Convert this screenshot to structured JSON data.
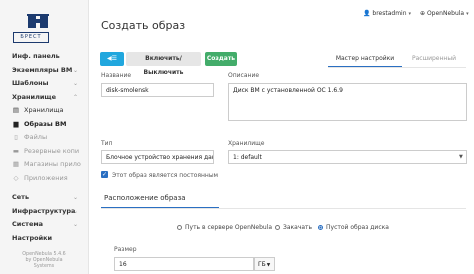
{
  "brand": {
    "logo_text": "БРЕСТ"
  },
  "header": {
    "title": "Создать образ",
    "user": "brestadmin",
    "zone": "OpenNebula"
  },
  "sidebar": {
    "items": [
      {
        "label": "Инф. панель"
      },
      {
        "label": "Экземпляры ВМ"
      },
      {
        "label": "Шаблоны"
      },
      {
        "label": "Хранилище"
      }
    ],
    "storage_subitems": [
      {
        "label": "Хранилища",
        "icon": "storage-icon"
      },
      {
        "label": "Образы ВМ",
        "icon": "image-icon"
      },
      {
        "label": "Файлы",
        "icon": "file-icon"
      },
      {
        "label": "Резервные копи",
        "icon": "backup-icon"
      },
      {
        "label": "Магазины прило",
        "icon": "store-icon"
      },
      {
        "label": "Приложения",
        "icon": "apps-icon"
      }
    ],
    "lower_items": [
      {
        "label": "Сеть"
      },
      {
        "label": "Инфраструктура"
      },
      {
        "label": "Система"
      },
      {
        "label": "Настройки"
      }
    ],
    "version_lines": [
      "OpenNebula 5.4.6",
      "by OpenNebula",
      "Systems"
    ]
  },
  "toolbar": {
    "back_icon": "back-list-icon",
    "toggle_label": "Включить/Выключить",
    "create_label": "Создать"
  },
  "tabs": {
    "wizard": "Мастер настройки",
    "advanced": "Расширенный"
  },
  "form": {
    "name_label": "Название",
    "name_value": "disk-smolensk",
    "description_label": "Описание",
    "description_value": "Диск ВМ с установленной ОС 1.6.9",
    "type_label": "Тип",
    "type_value": "Блочное устройство хранения данных",
    "datastore_label": "Хранилище",
    "datastore_value": "1: default",
    "persistent_label": "Этот образ является постоянным",
    "persistent_checked": true
  },
  "location": {
    "section_title": "Расположение образа",
    "options": [
      {
        "label": "Путь в сервере OpenNebula",
        "selected": false
      },
      {
        "label": "Закачать",
        "selected": false
      },
      {
        "label": "Пустой образ диска",
        "selected": true
      }
    ],
    "size_label": "Размер",
    "size_value": "16",
    "size_unit": "ГБ"
  },
  "colors": {
    "accent": "#2a6fc2",
    "create": "#43ac6a",
    "back": "#21a7de"
  }
}
